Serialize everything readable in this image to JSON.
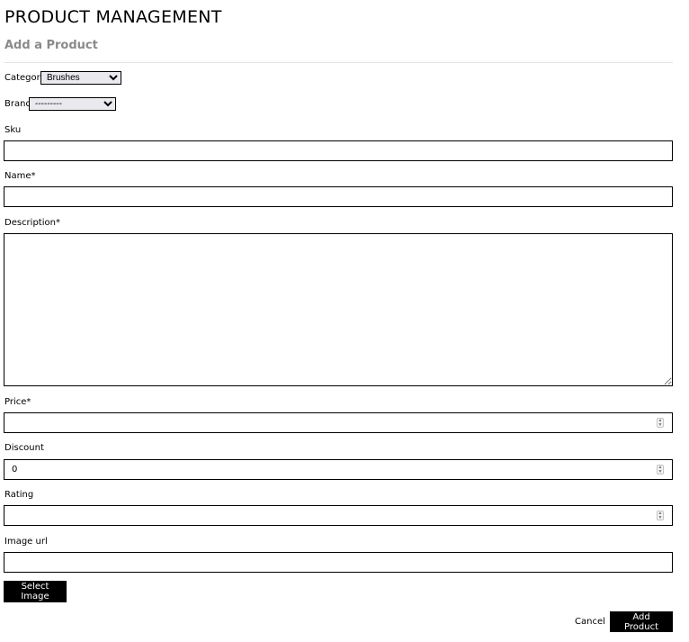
{
  "header": {
    "title": "PRODUCT MANAGEMENT",
    "subtitle": "Add a Product"
  },
  "form": {
    "category": {
      "label": "Category",
      "selected": "Brushes"
    },
    "brand": {
      "label": "Brand",
      "selected": "---------"
    },
    "sku": {
      "label": "Sku",
      "value": ""
    },
    "name": {
      "label": "Name*",
      "value": ""
    },
    "description": {
      "label": "Description*",
      "value": ""
    },
    "price": {
      "label": "Price*",
      "value": ""
    },
    "discount": {
      "label": "Discount",
      "value": "0"
    },
    "rating": {
      "label": "Rating",
      "value": ""
    },
    "image_url": {
      "label": "Image url",
      "value": ""
    }
  },
  "actions": {
    "select_image": "Select Image",
    "cancel": "Cancel",
    "add_product": "Add Product"
  }
}
